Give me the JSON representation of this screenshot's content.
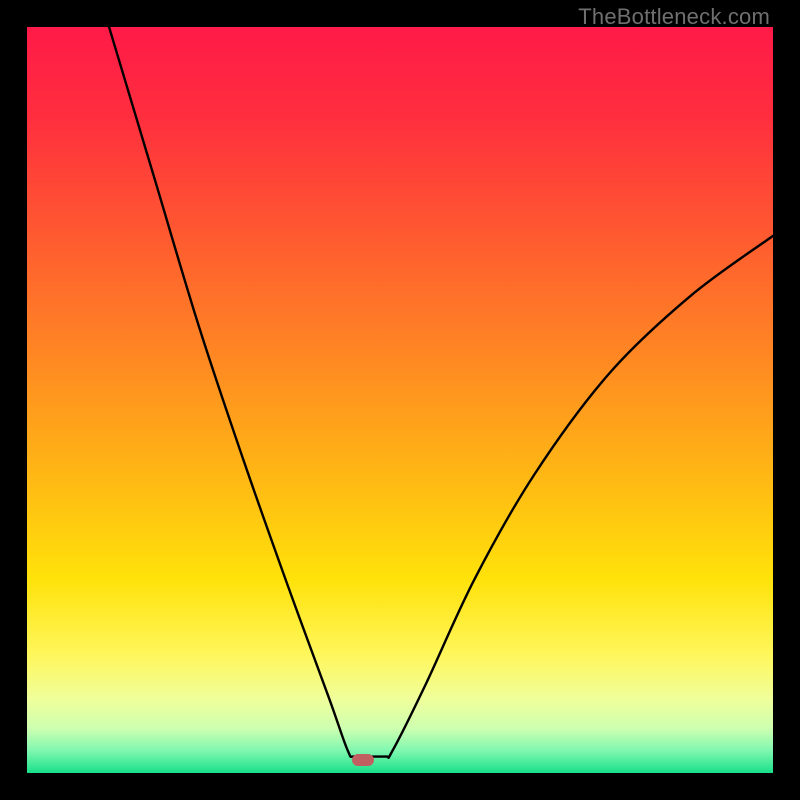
{
  "watermark": "TheBottleneck.com",
  "frame": {
    "bg": "#000000",
    "inner_left": 27,
    "inner_top": 27,
    "inner_w": 746,
    "inner_h": 746
  },
  "gradient_stops": [
    {
      "pct": 0,
      "color": "#ff1a48"
    },
    {
      "pct": 12,
      "color": "#ff2e3e"
    },
    {
      "pct": 28,
      "color": "#ff5a30"
    },
    {
      "pct": 45,
      "color": "#ff8a22"
    },
    {
      "pct": 60,
      "color": "#ffb714"
    },
    {
      "pct": 74,
      "color": "#ffe20a"
    },
    {
      "pct": 84,
      "color": "#fff65a"
    },
    {
      "pct": 90,
      "color": "#f0ff9a"
    },
    {
      "pct": 94,
      "color": "#ceffb0"
    },
    {
      "pct": 97,
      "color": "#80f7b0"
    },
    {
      "pct": 100,
      "color": "#18e08a"
    }
  ],
  "marker": {
    "x_frac": 0.45,
    "y_frac": 0.982,
    "color": "#c06060"
  },
  "chart_data": {
    "type": "line",
    "title": "",
    "xlabel": "",
    "ylabel": "",
    "xlim": [
      0,
      100
    ],
    "ylim": [
      0,
      100
    ],
    "note": "Axes are percentage positions in plot area; y=0 is bottom. Background color encodes y (red high → green low). Single V-shaped curve with flat trough; a small pill marker sits in the trough.",
    "series": [
      {
        "name": "curve",
        "points": [
          {
            "x": 11.0,
            "y": 100.0
          },
          {
            "x": 17.0,
            "y": 80.0
          },
          {
            "x": 23.0,
            "y": 60.0
          },
          {
            "x": 29.0,
            "y": 42.0
          },
          {
            "x": 35.0,
            "y": 25.0
          },
          {
            "x": 40.5,
            "y": 10.0
          },
          {
            "x": 43.0,
            "y": 3.0
          },
          {
            "x": 44.0,
            "y": 2.2
          },
          {
            "x": 48.0,
            "y": 2.2
          },
          {
            "x": 49.0,
            "y": 3.0
          },
          {
            "x": 53.5,
            "y": 12.0
          },
          {
            "x": 60.0,
            "y": 26.0
          },
          {
            "x": 68.0,
            "y": 40.0
          },
          {
            "x": 78.0,
            "y": 53.5
          },
          {
            "x": 89.0,
            "y": 64.0
          },
          {
            "x": 100.0,
            "y": 72.0
          }
        ]
      }
    ],
    "trough_x_range": [
      44.0,
      48.0
    ],
    "marker_point": {
      "x": 45.0,
      "y": 1.8
    }
  }
}
